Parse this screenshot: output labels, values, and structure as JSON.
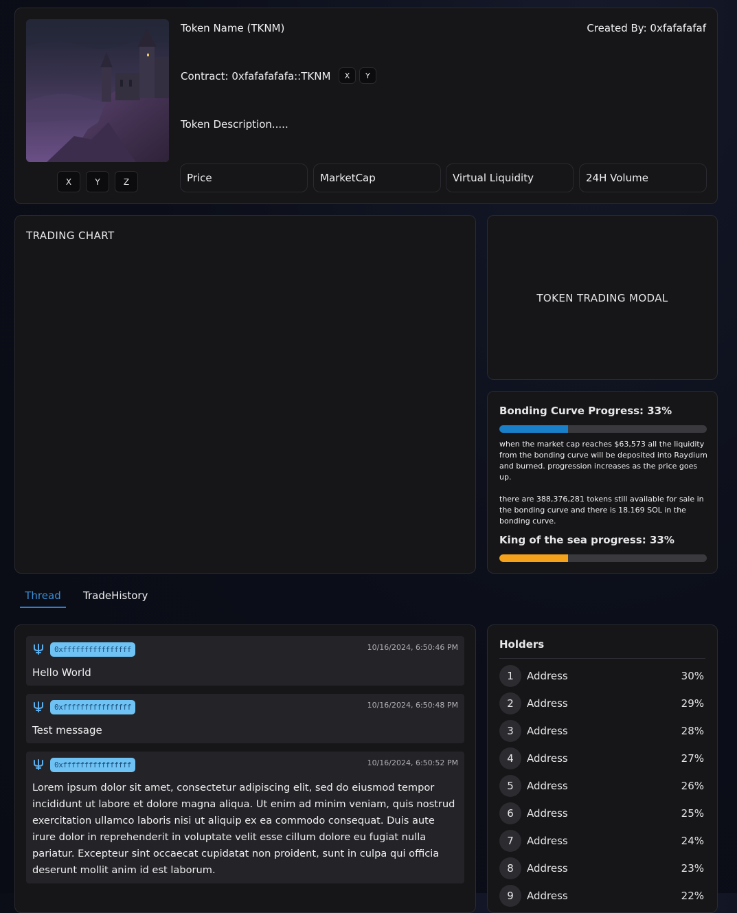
{
  "header": {
    "token_name": "Token Name (TKNM)",
    "created_by": "Created By: 0xfafafafaf",
    "contract": "Contract: 0xfafafafafa::TKNM",
    "contract_buttons": [
      "X",
      "Y"
    ],
    "description": "Token Description.....",
    "image_buttons": [
      "X",
      "Y",
      "Z"
    ],
    "stats": [
      "Price",
      "MarketCap",
      "Virtual Liquidity",
      "24H Volume"
    ]
  },
  "chart_panel": {
    "title": "TRADING CHART"
  },
  "trade_modal": {
    "title": "TOKEN TRADING MODAL"
  },
  "bonding": {
    "title": "Bonding Curve Progress: 33%",
    "progress": 0.33,
    "text1": "when the market cap reaches $63,573 all the liquidity from the bonding curve will be deposited into Raydium and burned. progression increases as the price goes up.",
    "text2": "there are 388,376,281 tokens still available for sale in the bonding curve and there is 18.169 SOL in the bonding curve.",
    "king_title": "King of the sea progress: 33%",
    "king_progress": 0.33,
    "colors": {
      "bonding": "#1a7fc9",
      "king": "#f4a21b"
    }
  },
  "tabs": [
    "Thread",
    "TradeHistory"
  ],
  "thread": {
    "messages": [
      {
        "user": "0xffffffffffffffff",
        "time": "10/16/2024, 6:50:46 PM",
        "text": "Hello World",
        "icon": "trident-icon"
      },
      {
        "user": "0xffffffffffffffff",
        "time": "10/16/2024, 6:50:48 PM",
        "text": "Test message",
        "icon": "trident-icon"
      },
      {
        "user": "0xffffffffffffffff",
        "time": "10/16/2024, 6:50:52 PM",
        "text": "Lorem ipsum dolor sit amet, consectetur adipiscing elit, sed do eiusmod tempor incididunt ut labore et dolore magna aliqua. Ut enim ad minim veniam, quis nostrud exercitation ullamco laboris nisi ut aliquip ex ea commodo consequat. Duis aute irure dolor in reprehenderit in voluptate velit esse cillum dolore eu fugiat nulla pariatur. Excepteur sint occaecat cupidatat non proident, sunt in culpa qui officia deserunt mollit anim id est laborum.",
        "icon": "trident-icon"
      }
    ]
  },
  "holders": {
    "title": "Holders",
    "rows": [
      {
        "rank": "1",
        "address": "Address",
        "pct": "30%"
      },
      {
        "rank": "2",
        "address": "Address",
        "pct": "29%"
      },
      {
        "rank": "3",
        "address": "Address",
        "pct": "28%"
      },
      {
        "rank": "4",
        "address": "Address",
        "pct": "27%"
      },
      {
        "rank": "5",
        "address": "Address",
        "pct": "26%"
      },
      {
        "rank": "6",
        "address": "Address",
        "pct": "25%"
      },
      {
        "rank": "7",
        "address": "Address",
        "pct": "24%"
      },
      {
        "rank": "8",
        "address": "Address",
        "pct": "23%"
      },
      {
        "rank": "9",
        "address": "Address",
        "pct": "22%"
      }
    ]
  }
}
